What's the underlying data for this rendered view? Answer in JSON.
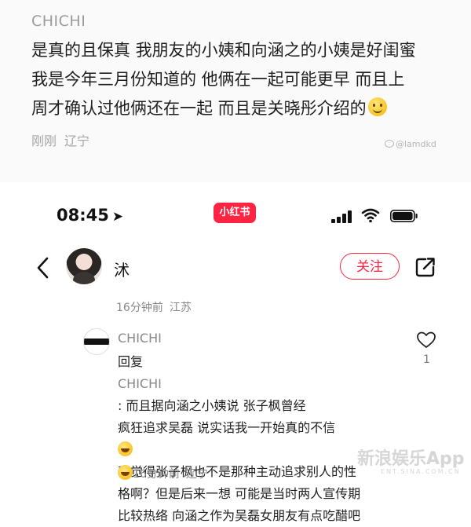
{
  "first_comment": {
    "username": "CHICHI",
    "lines": [
      "是真的且保真 我朋友的小姨和向涵之的小姨是好闺蜜",
      "我是今年三月份知道的 他俩在一起可能更早 而且上",
      "周才确认过他俩还在一起 而且是关晓彤介绍的"
    ],
    "emoji": "smile-emoji",
    "time": "刚刚",
    "location": "辽宁",
    "watermark": "@lamdkd"
  },
  "status_bar": {
    "time": "08:45",
    "location_arrow": "location-arrow-icon",
    "app_badge": "小红书",
    "icons": [
      "signal-icon",
      "wifi-icon",
      "battery-icon"
    ]
  },
  "header": {
    "back_icon": "chevron-left-icon",
    "username": "沭",
    "follow_label": "关注",
    "share_icon": "share-icon"
  },
  "post_meta": {
    "time": "16分钟前",
    "location": "江苏"
  },
  "reply": {
    "username": "CHICHI",
    "prefix": "回复",
    "target": "CHICHI",
    "line1_rest": ": 而且据向涵之小姨说 张子枫曾经",
    "lines": [
      "疯狂追求吴磊 说实话我一开始真的不信",
      "我觉得张子枫也不是那种主动追求别人的性",
      "格啊？但是后来一想 可能是当时两人宣传期",
      "比较热络 向涵之作为吴磊女朋友有点吃醋吧"
    ],
    "like_count": "1",
    "time": "16分钟前",
    "location": "辽宁"
  },
  "bottom_watermark": {
    "main": "新浪娱乐App",
    "sub": "ENT.SINA.COM.CN"
  }
}
